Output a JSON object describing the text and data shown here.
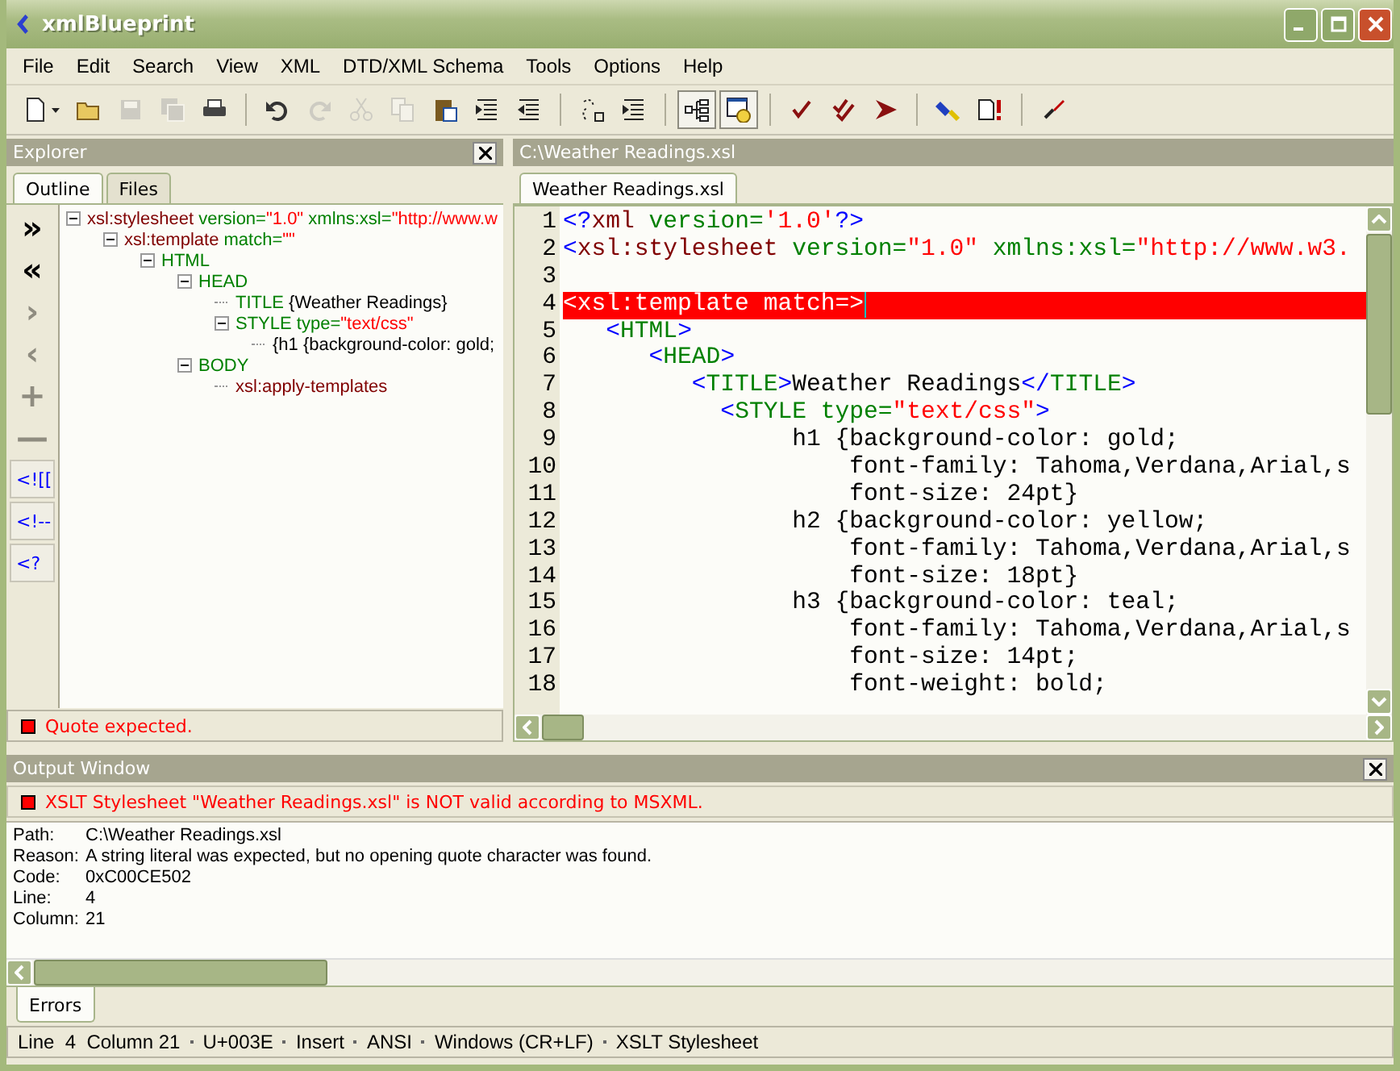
{
  "window": {
    "title": "xmlBlueprint"
  },
  "menu": [
    "File",
    "Edit",
    "Search",
    "View",
    "XML",
    "DTD/XML Schema",
    "Tools",
    "Options",
    "Help"
  ],
  "toolbar": [
    [
      {
        "kind": "new",
        "disabled": false
      },
      {
        "kind": "open",
        "disabled": false
      },
      {
        "kind": "save",
        "disabled": true
      },
      {
        "kind": "save-all",
        "disabled": true
      },
      {
        "kind": "print",
        "disabled": false
      }
    ],
    [
      {
        "kind": "undo",
        "disabled": false
      },
      {
        "kind": "redo",
        "disabled": true
      },
      {
        "kind": "cut",
        "disabled": true
      },
      {
        "kind": "copy",
        "disabled": true
      },
      {
        "kind": "paste",
        "disabled": false
      },
      {
        "kind": "indent",
        "disabled": false
      },
      {
        "kind": "outdent",
        "disabled": false
      }
    ],
    [
      {
        "kind": "rename",
        "disabled": false
      },
      {
        "kind": "format",
        "disabled": false
      }
    ],
    [
      {
        "kind": "tree",
        "disabled": false,
        "on": true
      },
      {
        "kind": "preview",
        "disabled": false,
        "on": true
      }
    ],
    [
      {
        "kind": "check",
        "disabled": false
      },
      {
        "kind": "check-double",
        "disabled": false
      },
      {
        "kind": "run",
        "disabled": false
      }
    ],
    [
      {
        "kind": "highlight",
        "disabled": false
      },
      {
        "kind": "doc-error",
        "disabled": false
      }
    ],
    [
      {
        "kind": "xml",
        "disabled": false
      }
    ]
  ],
  "explorer": {
    "title": "Explorer",
    "tabs": [
      {
        "label": "Outline",
        "selected": true
      },
      {
        "label": "Files",
        "selected": false
      }
    ],
    "side_buttons": [
      {
        "text": "»",
        "disabled": false
      },
      {
        "text": "«",
        "disabled": false
      },
      {
        "text": "›",
        "disabled": true
      },
      {
        "text": "‹",
        "disabled": true
      },
      {
        "text": "+",
        "disabled": true
      },
      {
        "text": "—",
        "disabled": true
      },
      {
        "text": "<![[",
        "disabled": false
      },
      {
        "text": "<!--",
        "disabled": false
      },
      {
        "text": "<?",
        "disabled": false
      }
    ],
    "tree": [
      {
        "expanded": true,
        "tokens": [
          {
            "kind": "xsl",
            "text": "xsl:stylesheet "
          },
          {
            "kind": "attr",
            "text": "version="
          },
          {
            "kind": "value",
            "text": "\"1.0\" "
          },
          {
            "kind": "attr",
            "text": "xmlns:xsl="
          },
          {
            "kind": "value",
            "text": "\"http://www.w"
          }
        ],
        "children": [
          {
            "expanded": true,
            "tokens": [
              {
                "kind": "xsl",
                "text": "xsl:template "
              },
              {
                "kind": "attr",
                "text": "match="
              },
              {
                "kind": "value",
                "text": "\"\""
              }
            ],
            "children": [
              {
                "expanded": true,
                "tokens": [
                  {
                    "kind": "element",
                    "text": "HTML"
                  }
                ],
                "children": [
                  {
                    "expanded": true,
                    "tokens": [
                      {
                        "kind": "element",
                        "text": "HEAD"
                      }
                    ],
                    "children": [
                      {
                        "tokens": [
                          {
                            "kind": "element",
                            "text": "TITLE "
                          },
                          {
                            "kind": "text",
                            "text": "{Weather Readings}"
                          }
                        ]
                      },
                      {
                        "expanded": true,
                        "tokens": [
                          {
                            "kind": "element",
                            "text": "STYLE "
                          },
                          {
                            "kind": "attr",
                            "text": "type="
                          },
                          {
                            "kind": "value",
                            "text": "\"text/css\""
                          }
                        ],
                        "children": [
                          {
                            "tokens": [
                              {
                                "kind": "text",
                                "text": "{h1 {background-color: gold;"
                              }
                            ]
                          }
                        ]
                      }
                    ]
                  },
                  {
                    "expanded": true,
                    "tokens": [
                      {
                        "kind": "element",
                        "text": "BODY"
                      }
                    ],
                    "children": [
                      {
                        "tokens": [
                          {
                            "kind": "xsl",
                            "text": "xsl:apply-templates"
                          }
                        ]
                      }
                    ]
                  }
                ]
              }
            ]
          }
        ]
      }
    ],
    "status": "Quote expected."
  },
  "editor": {
    "path": "C:\\Weather Readings.xsl",
    "tabs": [
      {
        "label": "Weather Readings.xsl",
        "selected": true
      }
    ],
    "lines": [
      {
        "number": "1",
        "error": false,
        "tokens": [
          {
            "kind": "bracket",
            "text": "<?"
          },
          {
            "kind": "xsl",
            "text": "xml "
          },
          {
            "kind": "attr",
            "text": "version="
          },
          {
            "kind": "value",
            "text": "'1.0'"
          },
          {
            "kind": "bracket",
            "text": "?>"
          }
        ]
      },
      {
        "number": "2",
        "error": false,
        "tokens": [
          {
            "kind": "bracket",
            "text": "<"
          },
          {
            "kind": "xsl",
            "text": "xsl:stylesheet "
          },
          {
            "kind": "attr",
            "text": "version="
          },
          {
            "kind": "value",
            "text": "\"1.0\" "
          },
          {
            "kind": "attr",
            "text": "xmlns:xsl="
          },
          {
            "kind": "value",
            "text": "\"http://www.w3."
          }
        ]
      },
      {
        "number": "3",
        "error": false
      },
      {
        "number": "4",
        "error": true,
        "tokens": [
          {
            "kind": "text",
            "text": "<xsl:template match=>"
          }
        ]
      },
      {
        "number": "5",
        "error": false,
        "tokens": [
          {
            "kind": "bracket",
            "text": "   <"
          },
          {
            "kind": "element",
            "text": "HTML"
          },
          {
            "kind": "bracket",
            "text": ">"
          }
        ]
      },
      {
        "number": "6",
        "error": false,
        "tokens": [
          {
            "kind": "bracket",
            "text": "      <"
          },
          {
            "kind": "element",
            "text": "HEAD"
          },
          {
            "kind": "bracket",
            "text": ">"
          }
        ]
      },
      {
        "number": "7",
        "error": false,
        "tokens": [
          {
            "kind": "bracket",
            "text": "         <"
          },
          {
            "kind": "element",
            "text": "TITLE"
          },
          {
            "kind": "bracket",
            "text": ">"
          },
          {
            "kind": "text",
            "text": "Weather Readings"
          },
          {
            "kind": "bracket",
            "text": "</"
          },
          {
            "kind": "element",
            "text": "TITLE"
          },
          {
            "kind": "bracket",
            "text": ">"
          }
        ]
      },
      {
        "number": "8",
        "error": false,
        "tokens": [
          {
            "kind": "bracket",
            "text": "           <"
          },
          {
            "kind": "element",
            "text": "STYLE "
          },
          {
            "kind": "attr",
            "text": "type="
          },
          {
            "kind": "value",
            "text": "\"text/css\""
          },
          {
            "kind": "bracket",
            "text": ">"
          }
        ]
      },
      {
        "number": "9",
        "error": false,
        "tokens": [
          {
            "kind": "text",
            "text": "                h1 {background-color: gold;"
          }
        ]
      },
      {
        "number": "10",
        "error": false,
        "tokens": [
          {
            "kind": "text",
            "text": "                    font-family: Tahoma,Verdana,Arial,s"
          }
        ]
      },
      {
        "number": "11",
        "error": false,
        "tokens": [
          {
            "kind": "text",
            "text": "                    font-size: 24pt}"
          }
        ]
      },
      {
        "number": "12",
        "error": false,
        "tokens": [
          {
            "kind": "text",
            "text": "                h2 {background-color: yellow;"
          }
        ]
      },
      {
        "number": "13",
        "error": false,
        "tokens": [
          {
            "kind": "text",
            "text": "                    font-family: Tahoma,Verdana,Arial,s"
          }
        ]
      },
      {
        "number": "14",
        "error": false,
        "tokens": [
          {
            "kind": "text",
            "text": "                    font-size: 18pt}"
          }
        ]
      },
      {
        "number": "15",
        "error": false,
        "tokens": [
          {
            "kind": "text",
            "text": "                h3 {background-color: teal;"
          }
        ]
      },
      {
        "number": "16",
        "error": false,
        "tokens": [
          {
            "kind": "text",
            "text": "                    font-family: Tahoma,Verdana,Arial,s"
          }
        ]
      },
      {
        "number": "17",
        "error": false,
        "tokens": [
          {
            "kind": "text",
            "text": "                    font-size: 14pt;"
          }
        ]
      },
      {
        "number": "18",
        "error": false,
        "tokens": [
          {
            "kind": "text",
            "text": "                    font-weight: bold;"
          }
        ]
      }
    ]
  },
  "output": {
    "title": "Output Window",
    "message": "XSLT Stylesheet \"Weather Readings.xsl\" is NOT valid according to MSXML.",
    "details": [
      {
        "label": "Path:",
        "value": "C:\\Weather Readings.xsl"
      },
      {
        "label": "Reason:",
        "value": "A string literal was expected, but no opening quote character was found."
      },
      {
        "label": "Code:",
        "value": "0xC00CE502"
      },
      {
        "label": "Line:",
        "value": "4"
      },
      {
        "label": "Column:",
        "value": "21"
      }
    ],
    "tabs": [
      {
        "label": "Errors",
        "selected": true
      }
    ]
  },
  "status_bar": [
    "Line  4  Column 21",
    "U+003E",
    "Insert",
    "ANSI",
    "Windows (CR+LF)",
    "XSLT Stylesheet"
  ]
}
